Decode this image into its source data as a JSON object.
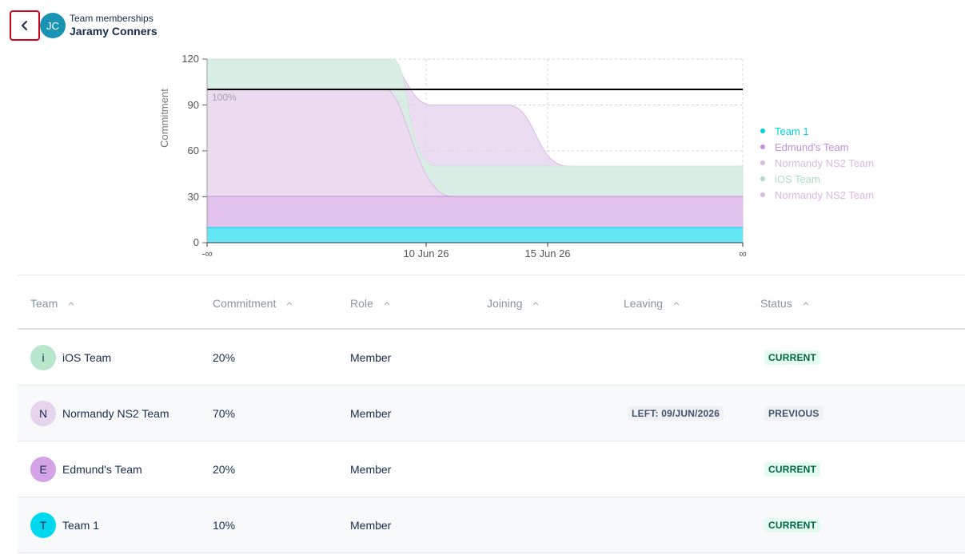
{
  "header": {
    "back_icon": "chevron-left-icon",
    "avatar_initials": "JC",
    "subtitle": "Team memberships",
    "name": "Jaramy Conners"
  },
  "chart_data": {
    "type": "area",
    "ylabel": "Commitment",
    "ylim": [
      0,
      120
    ],
    "yticks": [
      "0",
      "30",
      "60",
      "90",
      "120"
    ],
    "xticks": [
      "-∞",
      "10 Jun 26",
      "15 Jun 26",
      "∞"
    ],
    "reference_line": {
      "value": 100,
      "label": "100%"
    },
    "legend_position": "right",
    "legend": [
      {
        "name": "Team 1",
        "color": "#00d1e8"
      },
      {
        "name": "Edmund's Team",
        "color": "#c38fda"
      },
      {
        "name": "Normandy NS2 Team",
        "color": "#d9b8e6"
      },
      {
        "name": "iOS Team",
        "color": "#a9dfc3"
      },
      {
        "name": "Normandy NS2 Team",
        "color": "#d9b8e6"
      }
    ],
    "stacked_levels": {
      "Team 1": {
        "before": 10,
        "after": 10
      },
      "Edmund's Team": {
        "before": 30,
        "after": 30
      },
      "Normandy NS2 Team": {
        "before": 100,
        "after": 30
      },
      "iOS Team": {
        "before": 120,
        "after": 50
      },
      "Normandy NS2 Team (projected)": {
        "before": 120,
        "middle": 90,
        "after": 50
      }
    }
  },
  "table": {
    "headers": [
      "Team",
      "Commitment",
      "Role",
      "Joining",
      "Leaving",
      "Status"
    ],
    "rows": [
      {
        "avatar": "i",
        "avatar_color": "#b8e6cc",
        "team": "iOS Team",
        "commitment": "20%",
        "role": "Member",
        "joining": "",
        "leaving": "",
        "status": "CURRENT"
      },
      {
        "avatar": "N",
        "avatar_color": "#e6d3ee",
        "team": "Normandy NS2 Team",
        "commitment": "70%",
        "role": "Member",
        "joining": "",
        "leaving": "LEFT: 09/JUN/2026",
        "status": "PREVIOUS"
      },
      {
        "avatar": "E",
        "avatar_color": "#d3a3e6",
        "team": "Edmund's Team",
        "commitment": "20%",
        "role": "Member",
        "joining": "",
        "leaving": "",
        "status": "CURRENT"
      },
      {
        "avatar": "T",
        "avatar_color": "#00d8f0",
        "team": "Team 1",
        "commitment": "10%",
        "role": "Member",
        "joining": "",
        "leaving": "",
        "status": "CURRENT"
      }
    ]
  }
}
